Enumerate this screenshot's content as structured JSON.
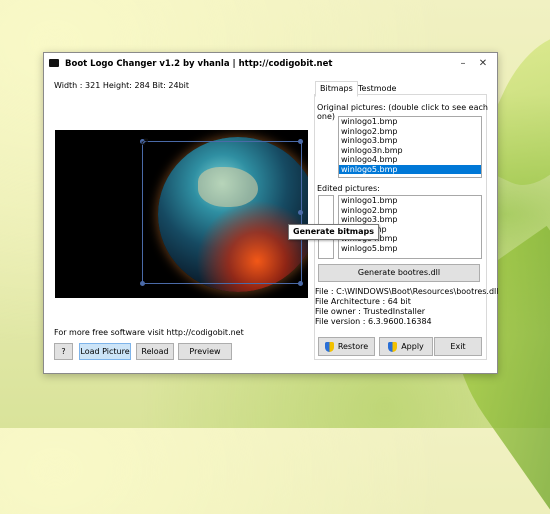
{
  "window": {
    "title": "Boot Logo Changer v1.2 by vhanla | http://codigobit.net",
    "minimize_glyph": "–",
    "close_glyph": "✕"
  },
  "image_info": "Width : 321 Height: 284 Bit: 24bit",
  "footer": {
    "promo": "For more free software visit  http://codigobit.net",
    "help_label": "?",
    "load_label": "Load Picture",
    "reload_label": "Reload",
    "preview_label": "Preview"
  },
  "tabs": [
    {
      "label": "Bitmaps",
      "active": true
    },
    {
      "label": "Testmode",
      "active": false
    }
  ],
  "original": {
    "label": "Original pictures: (double click to see each one)",
    "items": [
      "winlogo1.bmp",
      "winlogo2.bmp",
      "winlogo3.bmp",
      "winlogo3n.bmp",
      "winlogo4.bmp",
      "winlogo5.bmp"
    ],
    "selected": "winlogo5.bmp"
  },
  "edited": {
    "label": "Edited pictures:",
    "items": [
      "winlogo1.bmp",
      "winlogo2.bmp",
      "winlogo3.bmp",
      "n.bmp",
      "winlogo4.bmp",
      "winlogo5.bmp"
    ]
  },
  "tooltip": "Generate bitmaps",
  "generate_bootres_label": "Generate bootres.dll",
  "file_info": {
    "file": "File : C:\\WINDOWS\\Boot\\Resources\\bootres.dll",
    "architecture": "File Architecture : 64 bit",
    "owner": "File owner : TrustedInstaller",
    "version": "File version : 6.3.9600.16384"
  },
  "actions": {
    "restore_label": "Restore",
    "apply_label": "Apply",
    "exit_label": "Exit"
  }
}
